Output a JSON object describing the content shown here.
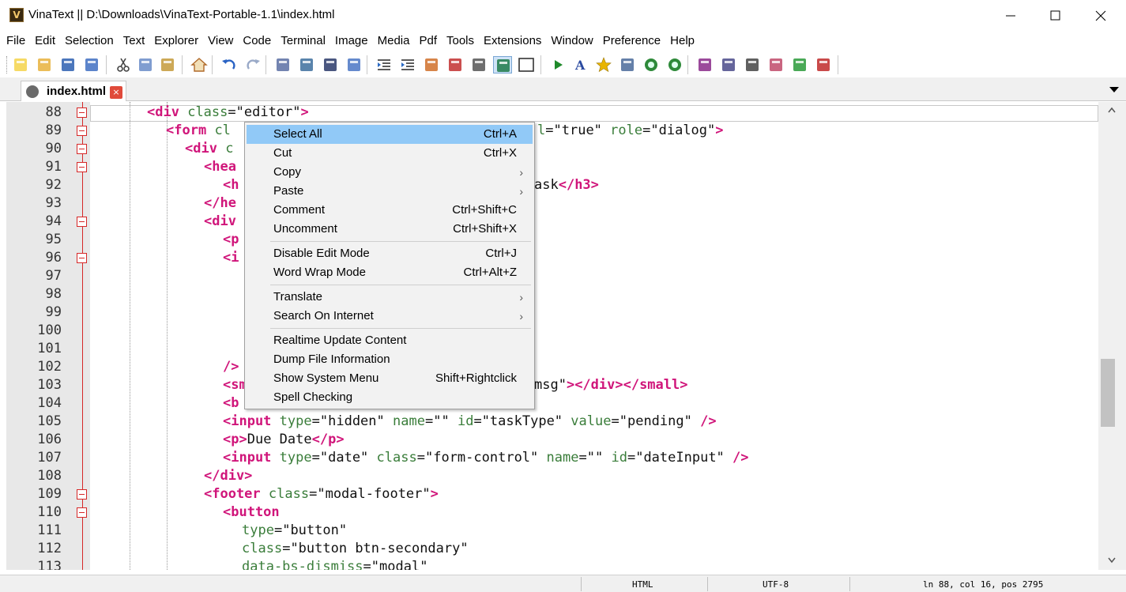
{
  "window": {
    "app_icon_letter": "V",
    "title": "VinaText || D:\\Downloads\\VinaText-Portable-1.1\\index.html"
  },
  "menubar": [
    "File",
    "Edit",
    "Selection",
    "Text",
    "Explorer",
    "View",
    "Code",
    "Terminal",
    "Image",
    "Media",
    "Pdf",
    "Tools",
    "Extensions",
    "Window",
    "Preference",
    "Help"
  ],
  "toolbar": {
    "icons": [
      "new-file-icon",
      "open-folder-icon",
      "save-icon",
      "save-all-icon",
      "cut-icon",
      "copy-icon",
      "paste-icon",
      "home-icon",
      "undo-icon",
      "redo-icon",
      "document-icon",
      "image-compare-icon",
      "find-icon",
      "replace-icon",
      "indent-icon",
      "outdent-icon",
      "hand-icon",
      "image-remove-icon",
      "properties-icon",
      "split-view-icon",
      "window-icon",
      "run-icon",
      "font-icon",
      "star-icon",
      "layers-icon",
      "back-icon",
      "forward-icon",
      "image-edit-icon",
      "image-list-icon",
      "window-stack-icon",
      "book-icon",
      "refresh-icon",
      "close-document-icon"
    ]
  },
  "tab": {
    "label": "index.html",
    "close_symbol": "×"
  },
  "editor": {
    "current_line": 88,
    "lines": [
      {
        "n": "88",
        "fold": true
      },
      {
        "n": "89",
        "fold": true
      },
      {
        "n": "90",
        "fold": true
      },
      {
        "n": "91",
        "fold": true
      },
      {
        "n": "92",
        "fold": false
      },
      {
        "n": "93",
        "fold": false
      },
      {
        "n": "94",
        "fold": true
      },
      {
        "n": "95",
        "fold": false
      },
      {
        "n": "96",
        "fold": true
      },
      {
        "n": "97",
        "fold": false
      },
      {
        "n": "98",
        "fold": false
      },
      {
        "n": "99",
        "fold": false
      },
      {
        "n": "100",
        "fold": false
      },
      {
        "n": "101",
        "fold": false
      },
      {
        "n": "102",
        "fold": false
      },
      {
        "n": "103",
        "fold": false
      },
      {
        "n": "104",
        "fold": false
      },
      {
        "n": "105",
        "fold": false
      },
      {
        "n": "106",
        "fold": false
      },
      {
        "n": "107",
        "fold": false
      },
      {
        "n": "108",
        "fold": false
      },
      {
        "n": "109",
        "fold": true
      },
      {
        "n": "110",
        "fold": true
      },
      {
        "n": "111",
        "fold": false
      },
      {
        "n": "112",
        "fold": false
      },
      {
        "n": "113",
        "fold": false
      }
    ],
    "code": {
      "l88": [
        [
          "tag",
          "<div"
        ],
        [
          "txt",
          " "
        ],
        [
          "attr",
          "class"
        ],
        [
          "txt",
          "="
        ],
        [
          "str",
          "\"editor\""
        ],
        [
          "tag",
          ">"
        ]
      ],
      "l89": [
        [
          "tag",
          "<form"
        ],
        [
          "txt",
          " "
        ],
        [
          "attr",
          "cl"
        ],
        [
          "gap",
          ""
        ],
        [
          "attr",
          "l"
        ],
        [
          "txt",
          "="
        ],
        [
          "str",
          "\"true\""
        ],
        [
          "txt",
          " "
        ],
        [
          "attr",
          "role"
        ],
        [
          "txt",
          "="
        ],
        [
          "str",
          "\"dialog\""
        ],
        [
          "tag",
          ">"
        ]
      ],
      "l90": [
        [
          "tag",
          "<div"
        ],
        [
          "txt",
          " "
        ],
        [
          "attr",
          "c"
        ]
      ],
      "l91": [
        [
          "tag",
          "<hea"
        ]
      ],
      "l92": [
        [
          "tag",
          "<h"
        ],
        [
          "gap",
          ""
        ],
        [
          "txt",
          "ask"
        ],
        [
          "tag",
          "</h3>"
        ]
      ],
      "l93": [
        [
          "tag",
          "</he"
        ]
      ],
      "l94": [
        [
          "tag",
          "<div"
        ]
      ],
      "l95": [
        [
          "tag",
          "<p"
        ]
      ],
      "l96": [
        [
          "tag",
          "<i"
        ]
      ],
      "l97": [
        [
          "txt",
          ""
        ]
      ],
      "l98": [
        [
          "txt",
          ""
        ]
      ],
      "l99": [
        [
          "txt",
          ""
        ]
      ],
      "l100": [
        [
          "txt",
          ""
        ]
      ],
      "l101": [
        [
          "txt",
          ""
        ]
      ],
      "l102": [
        [
          "tag",
          "/>"
        ]
      ],
      "l103": [
        [
          "tag",
          "<sm"
        ],
        [
          "gap",
          ""
        ],
        [
          "str",
          "msg\""
        ],
        [
          "tag",
          "></div></small>"
        ]
      ],
      "l104": [
        [
          "tag",
          "<b"
        ]
      ],
      "l105": [
        [
          "tag",
          "<input"
        ],
        [
          "txt",
          " "
        ],
        [
          "attr",
          "type"
        ],
        [
          "txt",
          "="
        ],
        [
          "str",
          "\"hidden\""
        ],
        [
          "txt",
          " "
        ],
        [
          "attr",
          "name"
        ],
        [
          "txt",
          "="
        ],
        [
          "str",
          "\"\""
        ],
        [
          "txt",
          " "
        ],
        [
          "attr",
          "id"
        ],
        [
          "txt",
          "="
        ],
        [
          "str",
          "\"taskType\""
        ],
        [
          "txt",
          " "
        ],
        [
          "attr",
          "value"
        ],
        [
          "txt",
          "="
        ],
        [
          "str",
          "\"pending\""
        ],
        [
          "txt",
          " "
        ],
        [
          "tag",
          "/>"
        ]
      ],
      "l106": [
        [
          "tag",
          "<p>"
        ],
        [
          "txt",
          "Due Date"
        ],
        [
          "tag",
          "</p>"
        ]
      ],
      "l107": [
        [
          "tag",
          "<input"
        ],
        [
          "txt",
          " "
        ],
        [
          "attr",
          "type"
        ],
        [
          "txt",
          "="
        ],
        [
          "str",
          "\"date\""
        ],
        [
          "txt",
          " "
        ],
        [
          "attr",
          "class"
        ],
        [
          "txt",
          "="
        ],
        [
          "str",
          "\"form-control\""
        ],
        [
          "txt",
          " "
        ],
        [
          "attr",
          "name"
        ],
        [
          "txt",
          "="
        ],
        [
          "str",
          "\"\""
        ],
        [
          "txt",
          " "
        ],
        [
          "attr",
          "id"
        ],
        [
          "txt",
          "="
        ],
        [
          "str",
          "\"dateInput\""
        ],
        [
          "txt",
          " "
        ],
        [
          "tag",
          "/>"
        ]
      ],
      "l108": [
        [
          "tag",
          "</div>"
        ]
      ],
      "l109": [
        [
          "tag",
          "<footer"
        ],
        [
          "txt",
          " "
        ],
        [
          "attr",
          "class"
        ],
        [
          "txt",
          "="
        ],
        [
          "str",
          "\"modal-footer\""
        ],
        [
          "tag",
          ">"
        ]
      ],
      "l110": [
        [
          "tag",
          "<button"
        ]
      ],
      "l111": [
        [
          "attr",
          "type"
        ],
        [
          "txt",
          "="
        ],
        [
          "str",
          "\"button\""
        ]
      ],
      "l112": [
        [
          "attr",
          "class"
        ],
        [
          "txt",
          "="
        ],
        [
          "str",
          "\"button btn-secondary\""
        ]
      ],
      "l113": [
        [
          "attr",
          "data-bs-dismiss"
        ],
        [
          "txt",
          "="
        ],
        [
          "str",
          "\"modal\""
        ]
      ]
    }
  },
  "context_menu": {
    "items": [
      {
        "label": "Select All",
        "shortcut": "Ctrl+A",
        "submenu": false,
        "selected": true
      },
      {
        "label": "Cut",
        "shortcut": "Ctrl+X",
        "submenu": false
      },
      {
        "label": "Copy",
        "shortcut": "",
        "submenu": true
      },
      {
        "label": "Paste",
        "shortcut": "",
        "submenu": true
      },
      {
        "label": "Comment",
        "shortcut": "Ctrl+Shift+C",
        "submenu": false
      },
      {
        "label": "Uncomment",
        "shortcut": "Ctrl+Shift+X",
        "submenu": false
      },
      {
        "label": "Disable Edit Mode",
        "shortcut": "Ctrl+J",
        "submenu": false
      },
      {
        "label": "Word Wrap Mode",
        "shortcut": "Ctrl+Alt+Z",
        "submenu": false
      },
      {
        "label": "Translate",
        "shortcut": "",
        "submenu": true
      },
      {
        "label": "Search On Internet",
        "shortcut": "",
        "submenu": true
      },
      {
        "label": "Realtime Update Content",
        "shortcut": "",
        "submenu": false
      },
      {
        "label": "Dump File Information",
        "shortcut": "",
        "submenu": false
      },
      {
        "label": "Show System Menu",
        "shortcut": "Shift+Rightclick",
        "submenu": false
      },
      {
        "label": "Spell Checking",
        "shortcut": "",
        "submenu": false
      }
    ],
    "submenu_arrow": "›"
  },
  "statusbar": {
    "language": "HTML",
    "encoding": "UTF-8",
    "position": "ln 88, col 16, pos 2795"
  },
  "colors": {
    "tag": "#d0157a",
    "attr": "#3a7d3a",
    "fold": "#d62828",
    "menu_selected": "#91c9f7"
  }
}
